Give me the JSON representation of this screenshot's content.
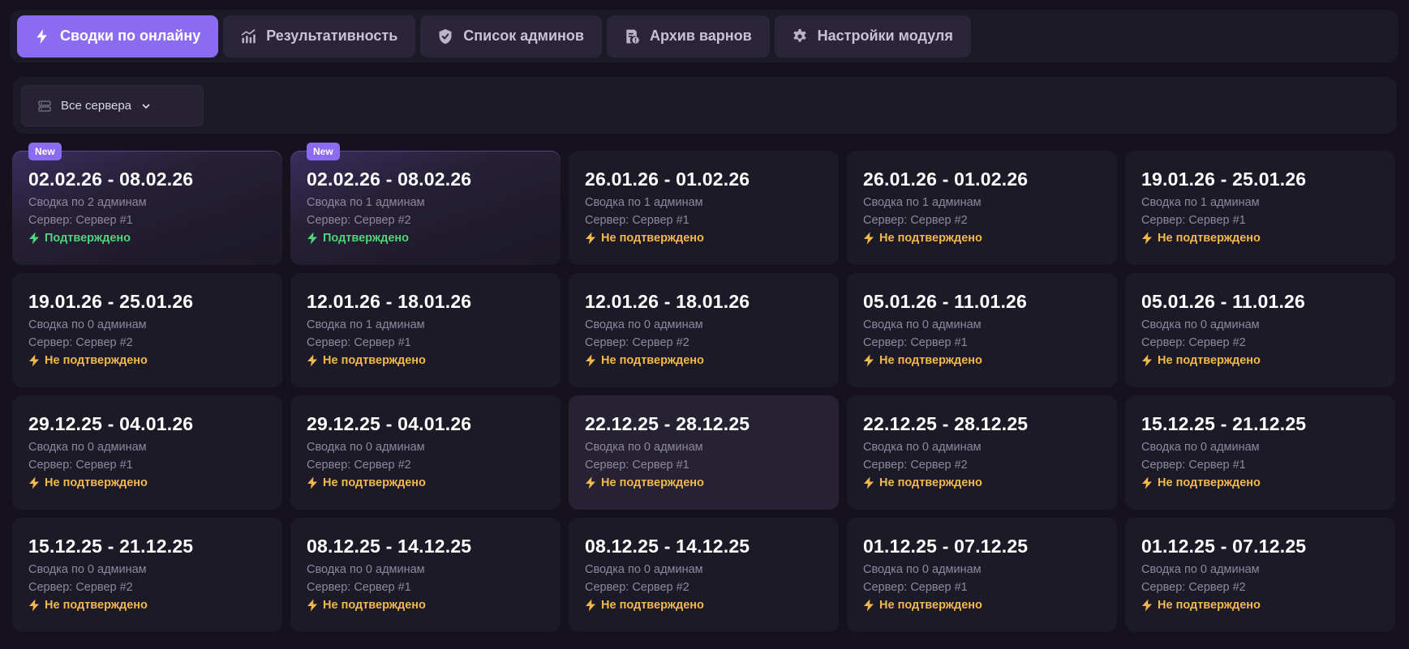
{
  "tabs": [
    {
      "label": "Сводки по онлайну",
      "icon": "bolt-icon",
      "active": true
    },
    {
      "label": "Результативность",
      "icon": "chart-icon",
      "active": false
    },
    {
      "label": "Список админов",
      "icon": "shield-icon",
      "active": false
    },
    {
      "label": "Архив варнов",
      "icon": "archive-icon",
      "active": false
    },
    {
      "label": "Настройки модуля",
      "icon": "gear-icon",
      "active": false
    }
  ],
  "filter": {
    "server_label": "Все сервера"
  },
  "badge_label": "New",
  "colors": {
    "accent": "#8b6cf0",
    "confirmed": "#4fd47a",
    "unconfirmed": "#f2b84b"
  },
  "cards": [
    {
      "range": "02.02.26 - 08.02.26",
      "summary": "Сводка по 2 админам",
      "server": "Сервер: Сервер #1",
      "status": "Подтверждено"
    },
    {
      "range": "02.02.26 - 08.02.26",
      "summary": "Сводка по 1 админам",
      "server": "Сервер: Сервер #2",
      "status": "Подтверждено"
    },
    {
      "range": "26.01.26 - 01.02.26",
      "summary": "Сводка по 1 админам",
      "server": "Сервер: Сервер #1",
      "status": "Не подтверждено"
    },
    {
      "range": "26.01.26 - 01.02.26",
      "summary": "Сводка по 1 админам",
      "server": "Сервер: Сервер #2",
      "status": "Не подтверждено"
    },
    {
      "range": "19.01.26 - 25.01.26",
      "summary": "Сводка по 1 админам",
      "server": "Сервер: Сервер #1",
      "status": "Не подтверждено"
    },
    {
      "range": "19.01.26 - 25.01.26",
      "summary": "Сводка по 0 админам",
      "server": "Сервер: Сервер #2",
      "status": "Не подтверждено"
    },
    {
      "range": "12.01.26 - 18.01.26",
      "summary": "Сводка по 1 админам",
      "server": "Сервер: Сервер #1",
      "status": "Не подтверждено"
    },
    {
      "range": "12.01.26 - 18.01.26",
      "summary": "Сводка по 0 админам",
      "server": "Сервер: Сервер #2",
      "status": "Не подтверждено"
    },
    {
      "range": "05.01.26 - 11.01.26",
      "summary": "Сводка по 0 админам",
      "server": "Сервер: Сервер #1",
      "status": "Не подтверждено"
    },
    {
      "range": "05.01.26 - 11.01.26",
      "summary": "Сводка по 0 админам",
      "server": "Сервер: Сервер #2",
      "status": "Не подтверждено"
    },
    {
      "range": "29.12.25 - 04.01.26",
      "summary": "Сводка по 0 админам",
      "server": "Сервер: Сервер #1",
      "status": "Не подтверждено"
    },
    {
      "range": "29.12.25 - 04.01.26",
      "summary": "Сводка по 0 админам",
      "server": "Сервер: Сервер #2",
      "status": "Не подтверждено"
    },
    {
      "range": "22.12.25 - 28.12.25",
      "summary": "Сводка по 0 админам",
      "server": "Сервер: Сервер #1",
      "status": "Не подтверждено"
    },
    {
      "range": "22.12.25 - 28.12.25",
      "summary": "Сводка по 0 админам",
      "server": "Сервер: Сервер #2",
      "status": "Не подтверждено"
    },
    {
      "range": "15.12.25 - 21.12.25",
      "summary": "Сводка по 0 админам",
      "server": "Сервер: Сервер #1",
      "status": "Не подтверждено"
    },
    {
      "range": "15.12.25 - 21.12.25",
      "summary": "Сводка по 0 админам",
      "server": "Сервер: Сервер #2",
      "status": "Не подтверждено"
    },
    {
      "range": "08.12.25 - 14.12.25",
      "summary": "Сводка по 0 админам",
      "server": "Сервер: Сервер #1",
      "status": "Не подтверждено"
    },
    {
      "range": "08.12.25 - 14.12.25",
      "summary": "Сводка по 0 админам",
      "server": "Сервер: Сервер #2",
      "status": "Не подтверждено"
    },
    {
      "range": "01.12.25 - 07.12.25",
      "summary": "Сводка по 0 админам",
      "server": "Сервер: Сервер #1",
      "status": "Не подтверждено"
    },
    {
      "range": "01.12.25 - 07.12.25",
      "summary": "Сводка по 0 админам",
      "server": "Сервер: Сервер #2",
      "status": "Не подтверждено"
    }
  ]
}
